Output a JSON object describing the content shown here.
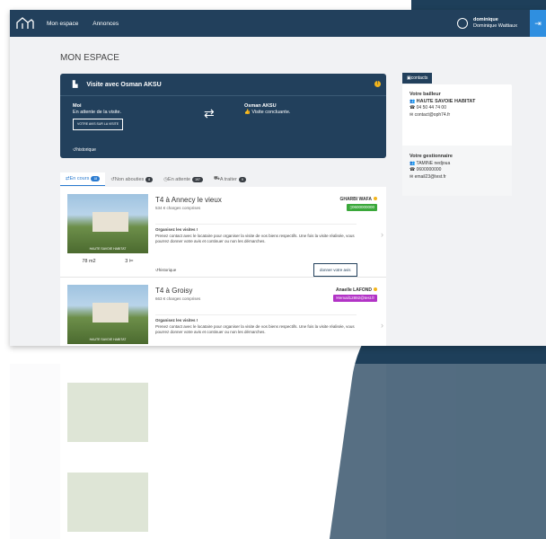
{
  "header": {
    "nav": [
      "Mon espace",
      "Annonces"
    ],
    "user_line1": "dominique",
    "user_line2": "Dominique Wattiaux"
  },
  "page": {
    "title": "MON ESPACE"
  },
  "visit": {
    "title": "Visite avec Osman AKSU",
    "me_label": "Moi",
    "me_status": "En attente de la visite.",
    "me_button": "VOTRE AVIS SUR LA VISITE",
    "other_name": "Osman AKSU",
    "other_status": "Visite concluante.",
    "history": "historique"
  },
  "tabs": [
    {
      "label": "En cours",
      "count": "18"
    },
    {
      "label": "Non abouties",
      "count": "8"
    },
    {
      "label": "En attente",
      "count": "197"
    },
    {
      "label": "A traiter",
      "count": "9"
    }
  ],
  "listings": [
    {
      "title": "T4 à Annecy le vieux",
      "price": "534 € charges comprises",
      "photo_tag": "HAUTE SAVOIE HABITAT",
      "area": "78 m2",
      "rooms": "3",
      "contact_name": "GHARBI WAFA",
      "contact_value": "0600000000",
      "contact_color": "#3aa83a",
      "msg_title": "Organisez les visites !",
      "msg_body": "Prenez contact avec le locataire pour organiser la visite de vos biens respectifs. Une fois la visite réalisée, vous pourrez donner votre avis et continuer ou non les démarches.",
      "history": "historique",
      "action": "donner votre avis"
    },
    {
      "title": "T4 à Groisy",
      "price": "663 € charges comprises",
      "photo_tag": "HAUTE SAVOIE HABITAT",
      "contact_name": "Anaelle LAFOND",
      "contact_value": "email12892@test.fr",
      "contact_color": "#b233c6",
      "msg_title": "Organisez les visites !",
      "msg_body": "Prenez contact avec le locataire pour organiser la visite de vos biens respectifs. Une fois la visite réalisée, vous pourrez donner votre avis et continuer ou non les démarches."
    }
  ],
  "sidebar": {
    "tab": "contacts",
    "bailleur_title": "Votre bailleur",
    "bailleur_name": "HAUTE SAVOIE HABITAT",
    "bailleur_phone": "04 50 44 74 00",
    "bailleur_email": "contact@oph74.fr",
    "gest_title": "Votre gestionnaire",
    "gest_name": "TAMINE nedjoua",
    "gest_phone": "0600000000",
    "gest_email": "email23@test.fr"
  }
}
